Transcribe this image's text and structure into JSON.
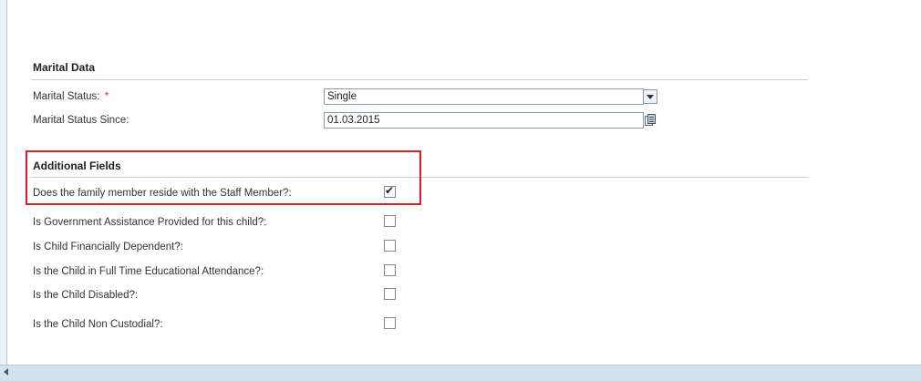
{
  "marital_data": {
    "title": "Marital Data",
    "status_label": "Marital Status:",
    "required_marker": "*",
    "status_value": "Single",
    "since_label": "Marital Status Since:",
    "since_value": "01.03.2015"
  },
  "additional_fields": {
    "title": "Additional Fields",
    "items": [
      {
        "label": "Does the family member reside with the Staff Member?:",
        "checked": true
      },
      {
        "label": "Is Government Assistance Provided for this child?:",
        "checked": false
      },
      {
        "label": "Is Child Financially Dependent?:",
        "checked": false
      },
      {
        "label": "Is the Child in Full Time Educational Attendance?:",
        "checked": false
      },
      {
        "label": "Is the Child Disabled?:",
        "checked": false
      },
      {
        "label": "Is the Child Non Custodial?:",
        "checked": false
      }
    ]
  },
  "icons": {
    "dropdown": "chevron-down-icon",
    "calendar": "calendar-icon",
    "scroll_left": "scroll-left-arrow-icon",
    "check": "checkmark-icon"
  },
  "colors": {
    "highlight": "#d4202a",
    "required": "#e0242b",
    "bottom_bar": "#d4e1ef"
  }
}
